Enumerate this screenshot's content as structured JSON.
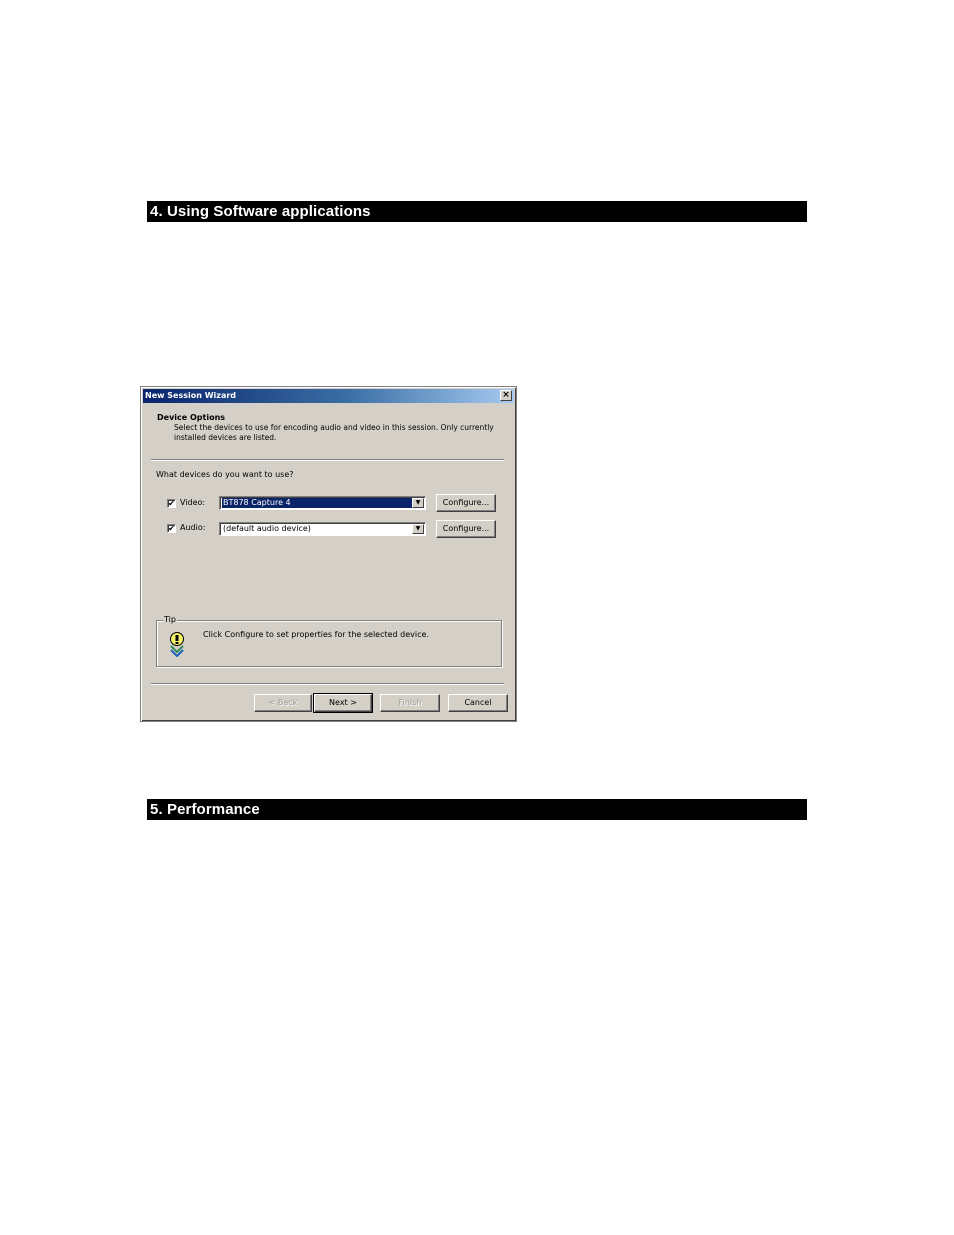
{
  "sections": {
    "s4_heading": "4. Using Software applications",
    "s5_heading": "5. Performance"
  },
  "dialog": {
    "title": "New Session Wizard",
    "close_glyph": "×",
    "page_title": "Device Options",
    "page_description": "Select the devices to use for encoding audio and video in this session. Only currently installed devices are listed.",
    "question": "What devices do you want to use?",
    "video": {
      "checked_glyph": "✔",
      "label": "Video:",
      "value": "BT878 Capture 4",
      "configure_label": "Configure..."
    },
    "audio": {
      "checked_glyph": "✔",
      "label": "Audio:",
      "value": "(default audio device)",
      "configure_label": "Configure..."
    },
    "dropdown_glyph": "▼",
    "tip": {
      "legend": "Tip",
      "icon": "lightbulb-tip-icon",
      "text": "Click Configure to set properties for the selected device."
    },
    "buttons": {
      "back": "< Back",
      "next": "Next >",
      "finish": "Finish",
      "cancel": "Cancel"
    }
  }
}
